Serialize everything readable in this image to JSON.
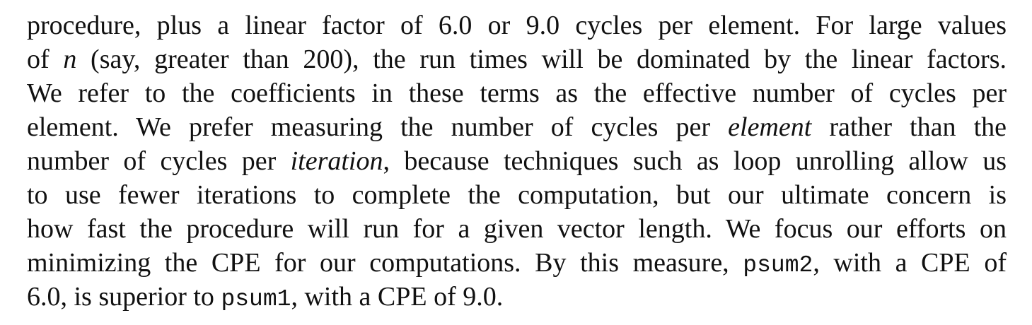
{
  "paragraph": {
    "line1": "procedure, plus a linear factor of 6.0 or 9.0 cycles per element. For large values",
    "line2_pre": "of ",
    "line2_italic": "n",
    "line2_post": " (say, greater than 200), the run times will be dominated by the linear factors.",
    "line3": "We refer to the coefficients in these terms as the effective number of cycles per",
    "line4_pre": "element. We prefer measuring the number of cycles per ",
    "line4_italic": "element",
    "line4_post": " rather than the",
    "line5_pre": "number of cycles per ",
    "line5_italic": "iteration",
    "line5_post": ", because techniques such as loop unrolling allow us",
    "line6": "to use fewer iterations to complete the computation, but our ultimate concern is",
    "line7": "how fast the procedure will run for a given vector length. We focus our efforts on",
    "line8_pre": "minimizing the CPE for our computations. By this measure, ",
    "line8_code": "psum2",
    "line8_post": ", with a CPE of",
    "line9_pre": "6.0, is superior to ",
    "line9_code": "psum1",
    "line9_post": ", with a CPE of 9.0."
  }
}
